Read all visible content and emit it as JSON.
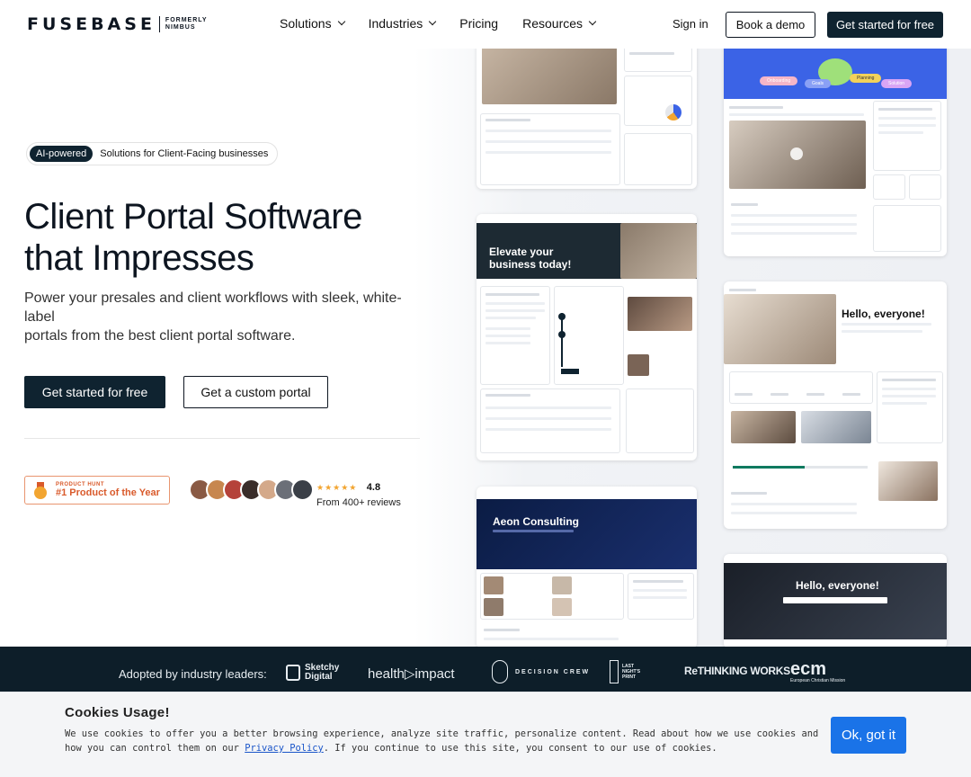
{
  "header": {
    "logo_word": "FUSEBASE",
    "logo_formerly_1": "FORMERLY",
    "logo_formerly_2": "NIMBUS",
    "nav": [
      "Solutions",
      "Industries",
      "Pricing",
      "Resources"
    ],
    "sign_in": "Sign in",
    "book_demo": "Book a demo",
    "get_started": "Get started for free"
  },
  "hero": {
    "pill_ai": "AI-powered",
    "pill_text": "Solutions for Client-Facing businesses",
    "title_line1": "Client Portal Software",
    "title_line2": "that Impresses",
    "subtitle_line1": "Power your presales and client workflows with sleek, white-",
    "subtitle_line2": "label",
    "subtitle_line3": "portals from the best client portal software.",
    "cta_primary": "Get started for free",
    "cta_secondary": "Get a custom portal"
  },
  "social_proof": {
    "ph_small": "PRODUCT HUNT",
    "ph_big": "#1 Product of the Year",
    "stars": "★★★★★",
    "score": "4.8",
    "reviews": "From 400+ reviews",
    "avatar_colors": [
      "#8a5a44",
      "#c7874f",
      "#b5423a",
      "#3a2d2a",
      "#d4a98a",
      "#6b6f78",
      "#3a3f47"
    ]
  },
  "mockups": {
    "c2_tags": [
      "Onboarding",
      "Goals",
      "Planning",
      "Solution"
    ],
    "c3_banner": "Elevate your business today!",
    "c4_banner": "Hello, everyone!",
    "c5_banner": "Aeon Consulting",
    "c6_banner": "Hello, everyone!"
  },
  "logos": {
    "label": "Adopted by industry leaders:",
    "items": [
      "Sketchy Digital",
      "health▷impact",
      "DECISION CREW",
      "LAST NIGHT'S PRINT",
      "ReTHINKING WORKS",
      "ecm"
    ],
    "ecm_sub": "European Christian Mission"
  },
  "cookie": {
    "title": "Cookies Usage!",
    "text_before": "We use cookies to offer you a better browsing experience, analyze site traffic, personalize content. Read about how we use cookies and how you can control them on our ",
    "link": "Privacy Policy",
    "text_after": ". If you continue to use this site, you consent to our use of cookies.",
    "button": "Ok, got it"
  },
  "colors": {
    "dark": "#0f2330",
    "accent_blue": "#1a73e8",
    "product_hunt": "#d95a2b"
  }
}
